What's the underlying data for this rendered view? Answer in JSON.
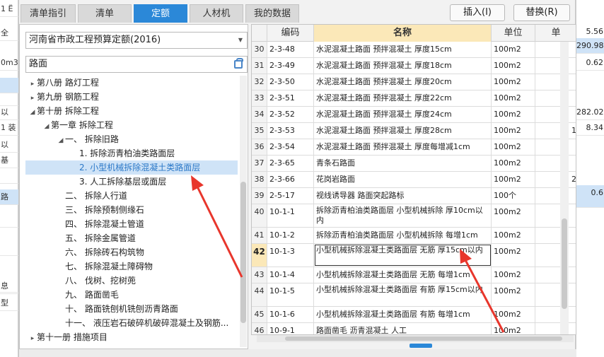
{
  "background_left": {
    "items": [
      "1 Ë",
      "全",
      "0m3",
      "",
      "",
      "以",
      "1 装",
      "以",
      "基",
      "",
      "",
      "路",
      "",
      "",
      "",
      "息",
      "型"
    ]
  },
  "background_right": {
    "items": [
      "5.56",
      "290.98",
      "0.62",
      "282.02",
      "8.34",
      "0.6"
    ]
  },
  "tabs": [
    {
      "label": "清单指引",
      "active": false
    },
    {
      "label": "清单",
      "active": false
    },
    {
      "label": "定额",
      "active": true
    },
    {
      "label": "人材机",
      "active": false
    },
    {
      "label": "我的数据",
      "active": false
    }
  ],
  "buttons": {
    "insert": "插入(I)",
    "replace": "替换(R)"
  },
  "left": {
    "library_select": "河南省市政工程预算定额(2016)",
    "search_value": "路面"
  },
  "tree": [
    {
      "label": "第八册 路灯工程",
      "level": 0,
      "arrow": "▸"
    },
    {
      "label": "第九册 钢筋工程",
      "level": 0,
      "arrow": "▸"
    },
    {
      "label": "第十册 拆除工程",
      "level": 0,
      "arrow": "◢"
    },
    {
      "label": "第一章 拆除工程",
      "level": 1,
      "arrow": "◢"
    },
    {
      "label": "一、 拆除旧路",
      "level": 2,
      "arrow": "◢"
    },
    {
      "label": "1. 拆除沥青柏油类路面层",
      "level": 3,
      "arrow": ""
    },
    {
      "label": "2. 小型机械拆除混凝土类路面层",
      "level": 3,
      "arrow": "",
      "selected": true
    },
    {
      "label": "3. 人工拆除基层或面层",
      "level": 3,
      "arrow": ""
    },
    {
      "label": "二、 拆除人行道",
      "level": 2,
      "arrow": ""
    },
    {
      "label": "三、 拆除预制侧缘石",
      "level": 2,
      "arrow": ""
    },
    {
      "label": "四、 拆除混凝土管道",
      "level": 2,
      "arrow": ""
    },
    {
      "label": "五、 拆除金属管道",
      "level": 2,
      "arrow": ""
    },
    {
      "label": "六、 拆除砖石构筑物",
      "level": 2,
      "arrow": ""
    },
    {
      "label": "七、 拆除混凝土障碍物",
      "level": 2,
      "arrow": ""
    },
    {
      "label": "八、 伐树、挖树蔸",
      "level": 2,
      "arrow": ""
    },
    {
      "label": "九、 路面凿毛",
      "level": 2,
      "arrow": ""
    },
    {
      "label": "十、 路面铣刨机铣刨沥青路面",
      "level": 2,
      "arrow": ""
    },
    {
      "label": "十一、 液压岩石破碎机破碎混凝土及钢筋...",
      "level": 2,
      "arrow": ""
    },
    {
      "label": "第十一册 措施项目",
      "level": 0,
      "arrow": "▸"
    }
  ],
  "grid": {
    "headers": [
      "编码",
      "名称",
      "单位",
      "单"
    ],
    "rows": [
      {
        "n": "30",
        "code": "2-3-48",
        "name": "水泥混凝土路面 预拌混凝土 厚度15cm",
        "unit": "100m2",
        "extra": ""
      },
      {
        "n": "31",
        "code": "2-3-49",
        "name": "水泥混凝土路面 预拌混凝土 厚度18cm",
        "unit": "100m2",
        "extra": ""
      },
      {
        "n": "32",
        "code": "2-3-50",
        "name": "水泥混凝土路面 预拌混凝土 厚度20cm",
        "unit": "100m2",
        "extra": ""
      },
      {
        "n": "33",
        "code": "2-3-51",
        "name": "水泥混凝土路面 预拌混凝土 厚度22cm",
        "unit": "100m2",
        "extra": ""
      },
      {
        "n": "34",
        "code": "2-3-52",
        "name": "水泥混凝土路面 预拌混凝土 厚度24cm",
        "unit": "100m2",
        "extra": ""
      },
      {
        "n": "35",
        "code": "2-3-53",
        "name": "水泥混凝土路面 预拌混凝土 厚度28cm",
        "unit": "100m2",
        "extra": "1"
      },
      {
        "n": "36",
        "code": "2-3-54",
        "name": "水泥混凝土路面 预拌混凝土 厚度每增减1cm",
        "unit": "100m2",
        "extra": ""
      },
      {
        "n": "37",
        "code": "2-3-65",
        "name": "青条石路面",
        "unit": "100m2",
        "extra": ""
      },
      {
        "n": "38",
        "code": "2-3-66",
        "name": "花岗岩路面",
        "unit": "100m2",
        "extra": "2"
      },
      {
        "n": "39",
        "code": "2-5-17",
        "name": "视线诱导器 路面突起路标",
        "unit": "100个",
        "extra": ""
      },
      {
        "n": "40",
        "code": "10-1-1",
        "name": "拆除沥青柏油类路面层 小型机械拆除 厚10cm以内",
        "unit": "100m2",
        "extra": "",
        "tall": true
      },
      {
        "n": "41",
        "code": "10-1-2",
        "name": "拆除沥青柏油类路面层 小型机械拆除 每增1cm",
        "unit": "100m2",
        "extra": ""
      },
      {
        "n": "42",
        "code": "10-1-3",
        "name": "小型机械拆除混凝土类路面层 无筋 厚15cm以内",
        "unit": "100m2",
        "extra": "",
        "tall": true,
        "current": true
      },
      {
        "n": "43",
        "code": "10-1-4",
        "name": "小型机械拆除混凝土类路面层 无筋 每增1cm",
        "unit": "100m2",
        "extra": ""
      },
      {
        "n": "44",
        "code": "10-1-5",
        "name": "小型机械拆除混凝土类路面层 有筋 厚15cm以内",
        "unit": "100m2",
        "extra": "",
        "tall": true
      },
      {
        "n": "45",
        "code": "10-1-6",
        "name": "小型机械拆除混凝土类路面层 有筋 每增1cm",
        "unit": "100m2",
        "extra": ""
      },
      {
        "n": "46",
        "code": "10-9-1",
        "name": "路面凿毛 沥青混凝土 人工",
        "unit": "100m2",
        "extra": ""
      }
    ]
  },
  "colors": {
    "accent": "#2b88d8",
    "selection": "#cfe3f7",
    "header_highlight": "#fbe8b8",
    "arrow": "#e8362c"
  }
}
